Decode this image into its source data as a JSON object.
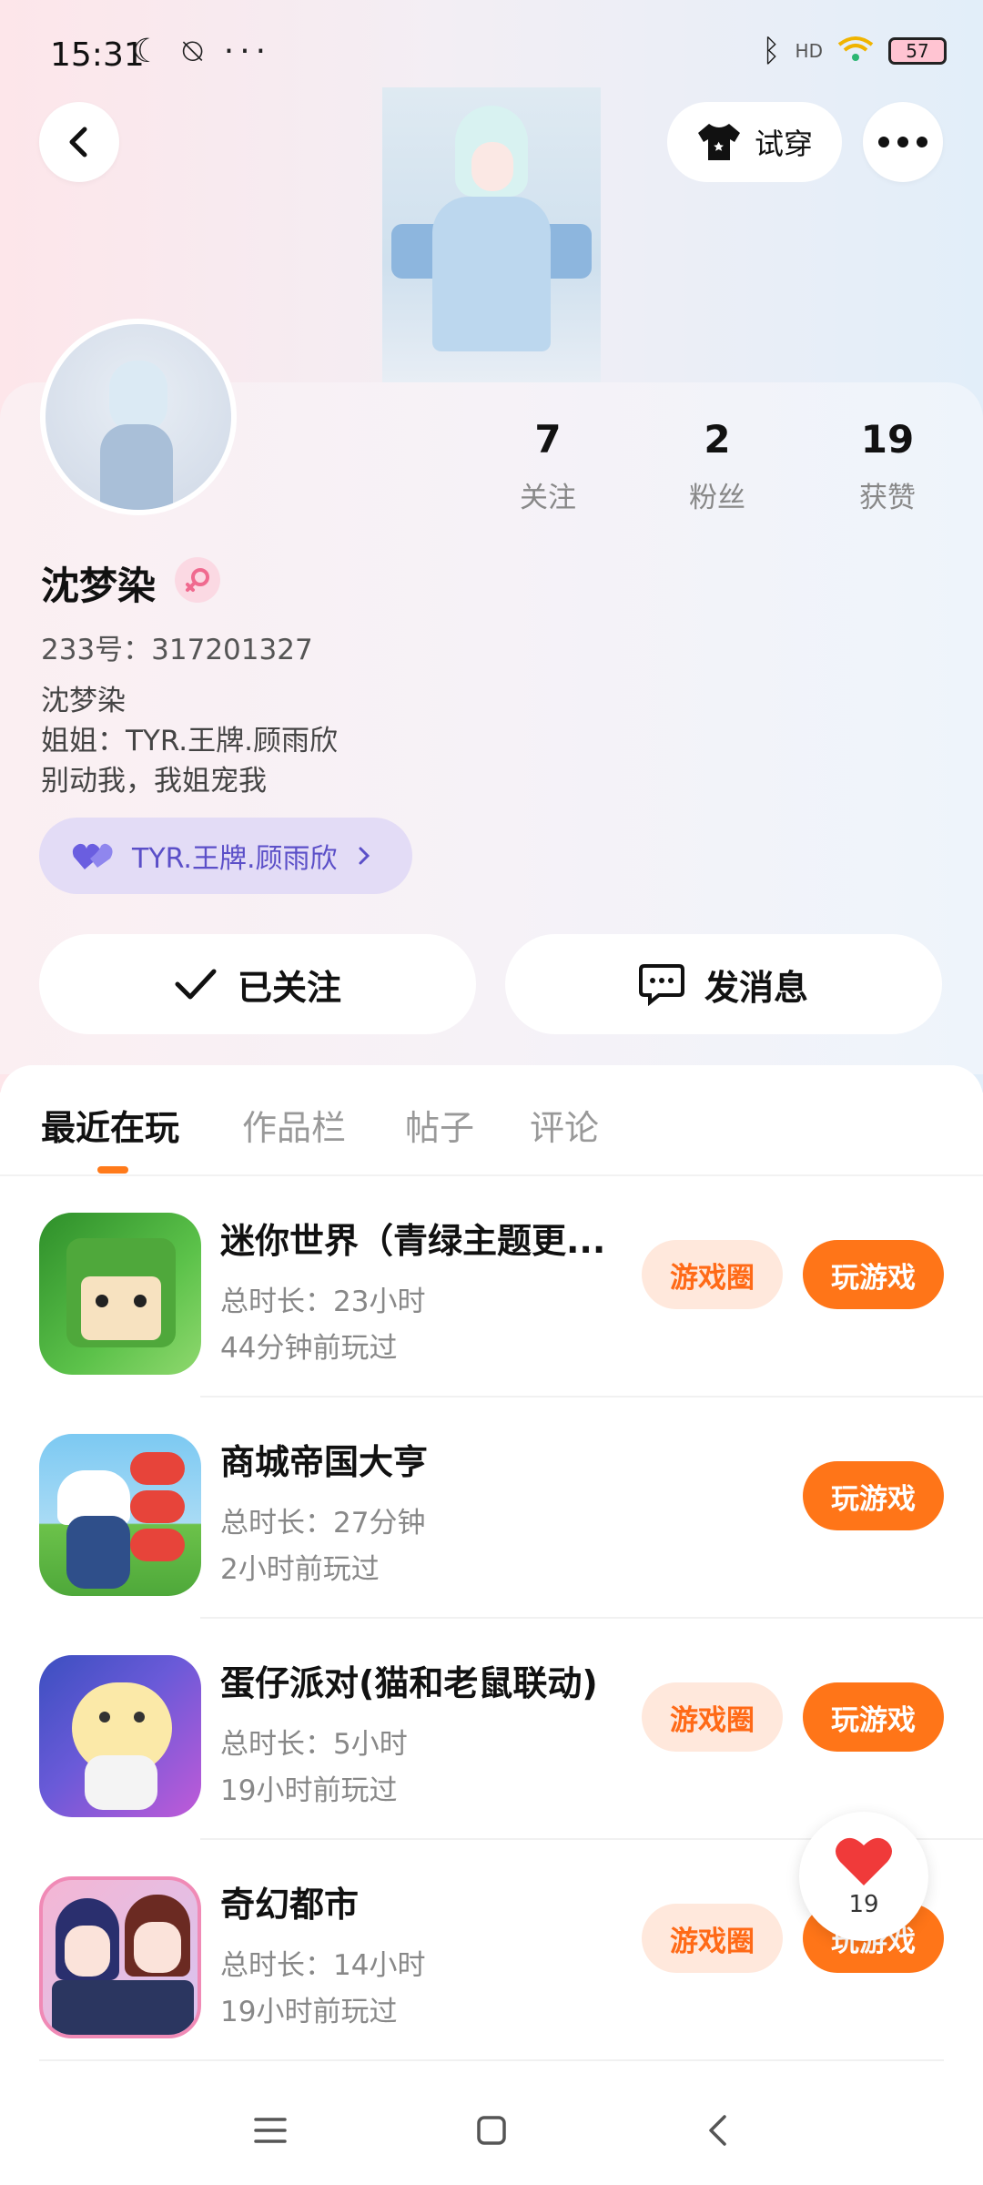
{
  "status_bar": {
    "time": "15:31",
    "battery": "57",
    "left_icons": "☾ ⍉",
    "dots": "···",
    "network": "HD"
  },
  "header": {
    "try_on_label": "试穿"
  },
  "profile": {
    "name": "沈梦染",
    "uid": "233号：317201327",
    "bio_lines": [
      "沈梦染",
      "姐姐：TYR.王牌.顾雨欣",
      "别动我，我姐宠我"
    ],
    "relation_label": "TYR.王牌.顾雨欣",
    "stats": [
      {
        "value": "7",
        "label": "关注"
      },
      {
        "value": "2",
        "label": "粉丝"
      },
      {
        "value": "19",
        "label": "获赞"
      }
    ]
  },
  "actions": {
    "followed_label": "已关注",
    "message_label": "发消息"
  },
  "tabs": [
    "最近在玩",
    "作品栏",
    "帖子",
    "评论"
  ],
  "games": [
    {
      "title": "迷你世界（青绿主题更...",
      "duration": "总时长：23小时",
      "last_played": "44分钟前玩过",
      "has_circle": true
    },
    {
      "title": "商城帝国大亨",
      "duration": "总时长：27分钟",
      "last_played": "2小时前玩过",
      "has_circle": false
    },
    {
      "title": "蛋仔派对(猫和老鼠联动)",
      "duration": "总时长：5小时",
      "last_played": "19小时前玩过",
      "has_circle": true
    },
    {
      "title": "奇幻都市",
      "duration": "总时长：14小时",
      "last_played": "19小时前玩过",
      "has_circle": true
    }
  ],
  "buttons": {
    "circle_label": "游戏圈",
    "play_label": "玩游戏"
  },
  "like_float": {
    "count": "19"
  },
  "colors": {
    "accent": "#ff7518",
    "accent_light": "#ffe8dc",
    "pill_bg": "#e3dcf6",
    "pill_text": "#5b4fc8"
  }
}
